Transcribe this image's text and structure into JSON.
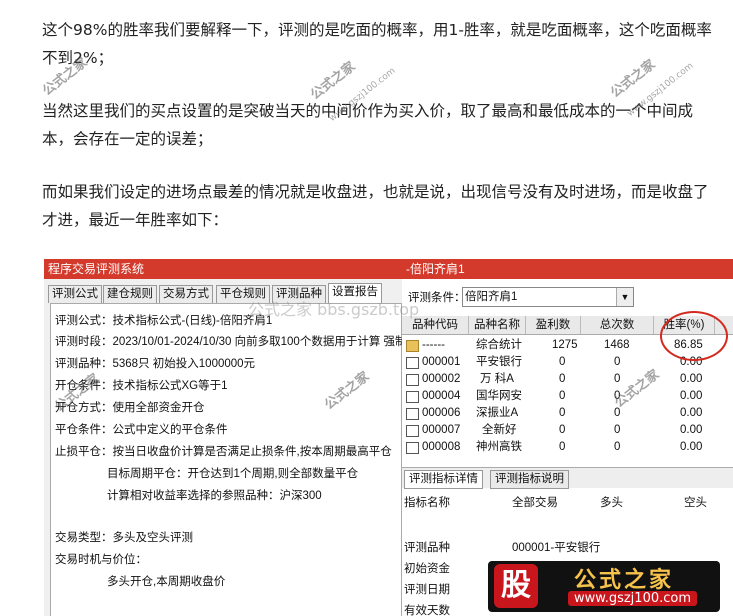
{
  "article": {
    "p1": "这个98%的胜率我们要解释一下，评测的是吃面的概率，用1-胜率，就是吃面概率，这个吃面概率不到2%；",
    "p2": "当然这里我们的买点设置的是突破当天的中间价作为买入价，取了最高和最低成本的一个中间成本，会存在一定的误差；",
    "p3": "而如果我们设定的进场点最差的情况就是收盘进，也就是说，出现信号没有及时进场，而是收盘了才进，最近一年胜率如下："
  },
  "left_window": {
    "title": "程序交易评测系统",
    "tabs": [
      "评测公式",
      "建仓规则",
      "交易方式",
      "平仓规则",
      "评测品种",
      "设置报告"
    ],
    "lines": [
      "评测公式：技术指标公式-(日线)-倍阳齐肩1",
      "评测时段：2023/10/01-2024/10/30 向前多取100个数据用于计算 强制",
      "评测品种：5368只 初始投入1000000元",
      "开仓条件：技术指标公式XG等于1",
      "开仓方式：使用全部资金开仓",
      "平仓条件：公式中定义的平仓条件",
      "止损平仓：按当日收盘价计算是否满足止损条件,按本周期最高平仓",
      "目标周期平仓：开仓达到1个周期,则全部数量平仓",
      "计算相对收益率选择的参照品种：沪深300",
      "",
      "交易类型：多头及空头评测",
      "交易时机与价位：",
      "多头开仓,本周期收盘价"
    ]
  },
  "right_window": {
    "title": "-倍阳齐肩1",
    "cond_label": "评测条件：",
    "cond_value": "倍阳齐肩1",
    "headers": [
      "品种代码",
      "品种名称",
      "盈利数",
      "总次数",
      "胜率(%)"
    ],
    "rows": [
      {
        "code": "------",
        "name": "综合统计",
        "profit": "1275",
        "total": "1468",
        "rate": "86.85",
        "folder": true
      },
      {
        "code": "000001",
        "name": "平安银行",
        "profit": "0",
        "total": "0",
        "rate": "0.00"
      },
      {
        "code": "000002",
        "name": "万 科A",
        "profit": "0",
        "total": "0",
        "rate": "0.00"
      },
      {
        "code": "000004",
        "name": "国华网安",
        "profit": "0",
        "total": "0",
        "rate": "0.00"
      },
      {
        "code": "000006",
        "name": "深振业A",
        "profit": "0",
        "total": "0",
        "rate": "0.00"
      },
      {
        "code": "000007",
        "name": "全新好",
        "profit": "0",
        "total": "0",
        "rate": "0.00"
      },
      {
        "code": "000008",
        "name": "神州高铁",
        "profit": "0",
        "total": "0",
        "rate": "0.00"
      }
    ],
    "bottom_tabs": [
      "评测指标详情",
      "评测指标说明"
    ],
    "bottom_headers": [
      "指标名称",
      "全部交易",
      "多头",
      "空头"
    ],
    "bottom_rows": [
      {
        "label": "评测品种",
        "value": "000001-平安银行"
      },
      {
        "label": "初始资金",
        "value": ""
      },
      {
        "label": "评测日期",
        "value": ""
      },
      {
        "label": "有效天数",
        "value": ""
      }
    ]
  },
  "watermarks": {
    "site_cn": "公式之家",
    "site_url": "www.gszj100.com",
    "bbs": "公式之家 bbs.gszb.top",
    "logo_char": "股",
    "logo_title": "公式之家",
    "logo_url": "www.gszj100.com"
  },
  "colors": {
    "titlebar": "#d43a2c",
    "highlight_circle": "#d42a1e",
    "logo_red": "#c9161d",
    "logo_gold": "#f6c24b"
  }
}
